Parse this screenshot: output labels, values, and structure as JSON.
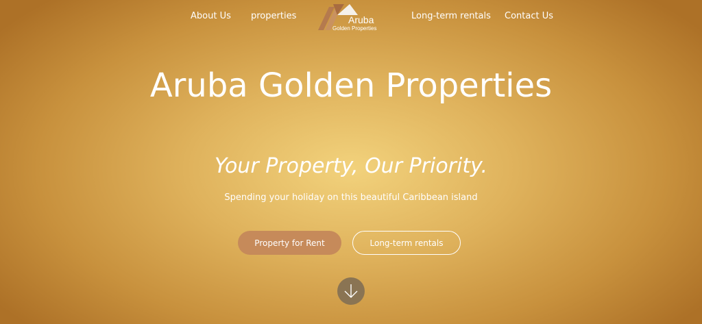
{
  "nav": {
    "about": "About Us",
    "properties": "properties",
    "long_term": "Long-term rentals",
    "contact": "Contact Us"
  },
  "logo": {
    "word": "Aruba",
    "sub": "Golden Properties",
    "icon": "house-roof-icon"
  },
  "hero": {
    "title": "Aruba Golden Properties",
    "tagline": "Your Property, Our Priority.",
    "subtitle": "Spending your holiday on this beautiful Caribbean island",
    "btn_rent": "Property for Rent",
    "btn_long": "Long-term rentals",
    "scroll_icon": "arrow-down-icon"
  },
  "colors": {
    "background_center": "#f2d27c",
    "background_edge": "#ad7127",
    "rent_button": "#c68a5a",
    "scroll_circle": "#8a7453"
  }
}
